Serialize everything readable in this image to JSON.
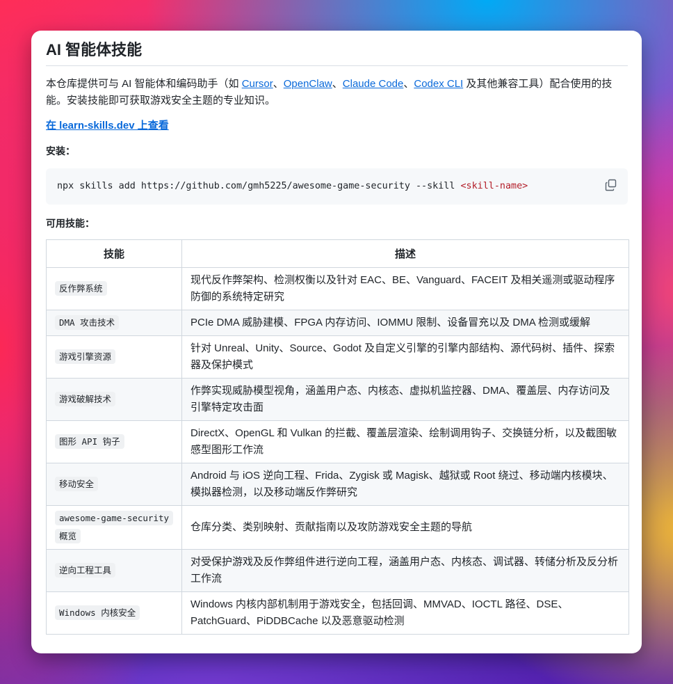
{
  "title": "AI 智能体技能",
  "intro": {
    "prefix": "本仓库提供可与 AI 智能体和编码助手（如 ",
    "links": [
      "Cursor",
      "OpenClaw",
      "Claude Code",
      "Codex CLI"
    ],
    "sep": "、",
    "suffix": " 及其他兼容工具）配合使用的技能。安装技能即可获取游戏安全主题的专业知识。"
  },
  "view_link": "在 learn-skills.dev 上查看",
  "install_label": "安装：",
  "install_cmd": {
    "command": "npx skills add https://github.com/gmh5225/awesome-game-security --skill ",
    "tag": "<skill-name>",
    "copy_icon": "copy-icon"
  },
  "available_label": "可用技能：",
  "table": {
    "headers": [
      "技能",
      "描述"
    ],
    "rows": [
      {
        "name": "反作弊系统",
        "desc": "现代反作弊架构、检测权衡以及针对 EAC、BE、Vanguard、FACEIT 及相关遥测或驱动程序防御的系统特定研究"
      },
      {
        "name": "DMA 攻击技术",
        "desc": "PCIe DMA 威胁建模、FPGA 内存访问、IOMMU 限制、设备冒充以及 DMA 检测或缓解"
      },
      {
        "name": "游戏引擎资源",
        "desc": "针对 Unreal、Unity、Source、Godot 及自定义引擎的引擎内部结构、源代码树、插件、探索器及保护模式"
      },
      {
        "name": "游戏破解技术",
        "desc": "作弊实现威胁模型视角，涵盖用户态、内核态、虚拟机监控器、DMA、覆盖层、内存访问及引擎特定攻击面"
      },
      {
        "name": "图形 API 钩子",
        "desc": "DirectX、OpenGL 和 Vulkan 的拦截、覆盖层渲染、绘制调用钩子、交换链分析，以及截图敏感型图形工作流"
      },
      {
        "name": "移动安全",
        "desc": "Android 与 iOS 逆向工程、Frida、Zygisk 或 Magisk、越狱或 Root 绕过、移动端内核模块、模拟器检测，以及移动端反作弊研究"
      },
      {
        "name": "awesome-game-security 概览",
        "desc": "仓库分类、类别映射、贡献指南以及攻防游戏安全主题的导航"
      },
      {
        "name": "逆向工程工具",
        "desc": "对受保护游戏及反作弊组件进行逆向工程，涵盖用户态、内核态、调试器、转储分析及反分析工作流"
      },
      {
        "name": "Windows 内核安全",
        "desc": "Windows 内核内部机制用于游戏安全，包括回调、MMVAD、IOCTL 路径、DSE、PatchGuard、PiDDBCache 以及恶意驱动检测"
      }
    ]
  }
}
